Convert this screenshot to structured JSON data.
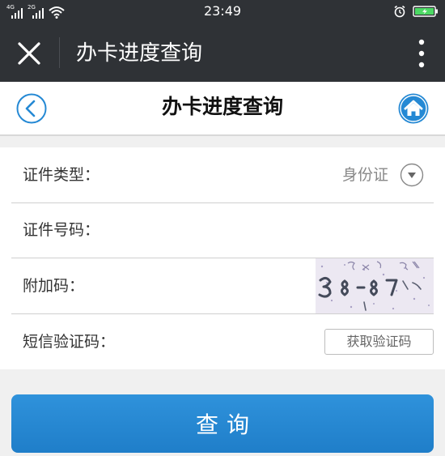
{
  "status_bar": {
    "time": "23:49",
    "network_1": "4G",
    "network_2": "2G"
  },
  "title_bar": {
    "title": "办卡进度查询"
  },
  "page_header": {
    "title": "办卡进度查询"
  },
  "form": {
    "id_type": {
      "label": "证件类型：",
      "value": "身份证"
    },
    "id_number": {
      "label": "证件号码：",
      "value": ""
    },
    "captcha": {
      "label": "附加码：",
      "value": ""
    },
    "sms_code": {
      "label": "短信验证码：",
      "value": "",
      "button_label": "获取验证码"
    }
  },
  "query_button": {
    "label": "查询"
  },
  "colors": {
    "top_bar": "#2f3236",
    "accent_blue": "#2589d4",
    "battery_green": "#4cd964",
    "background": "#f0f0f0"
  },
  "icons": {
    "close": "close-icon",
    "more": "more-vertical-icon",
    "back": "back-circle-icon",
    "home": "home-icon",
    "dropdown": "chevron-down-circle-icon"
  }
}
